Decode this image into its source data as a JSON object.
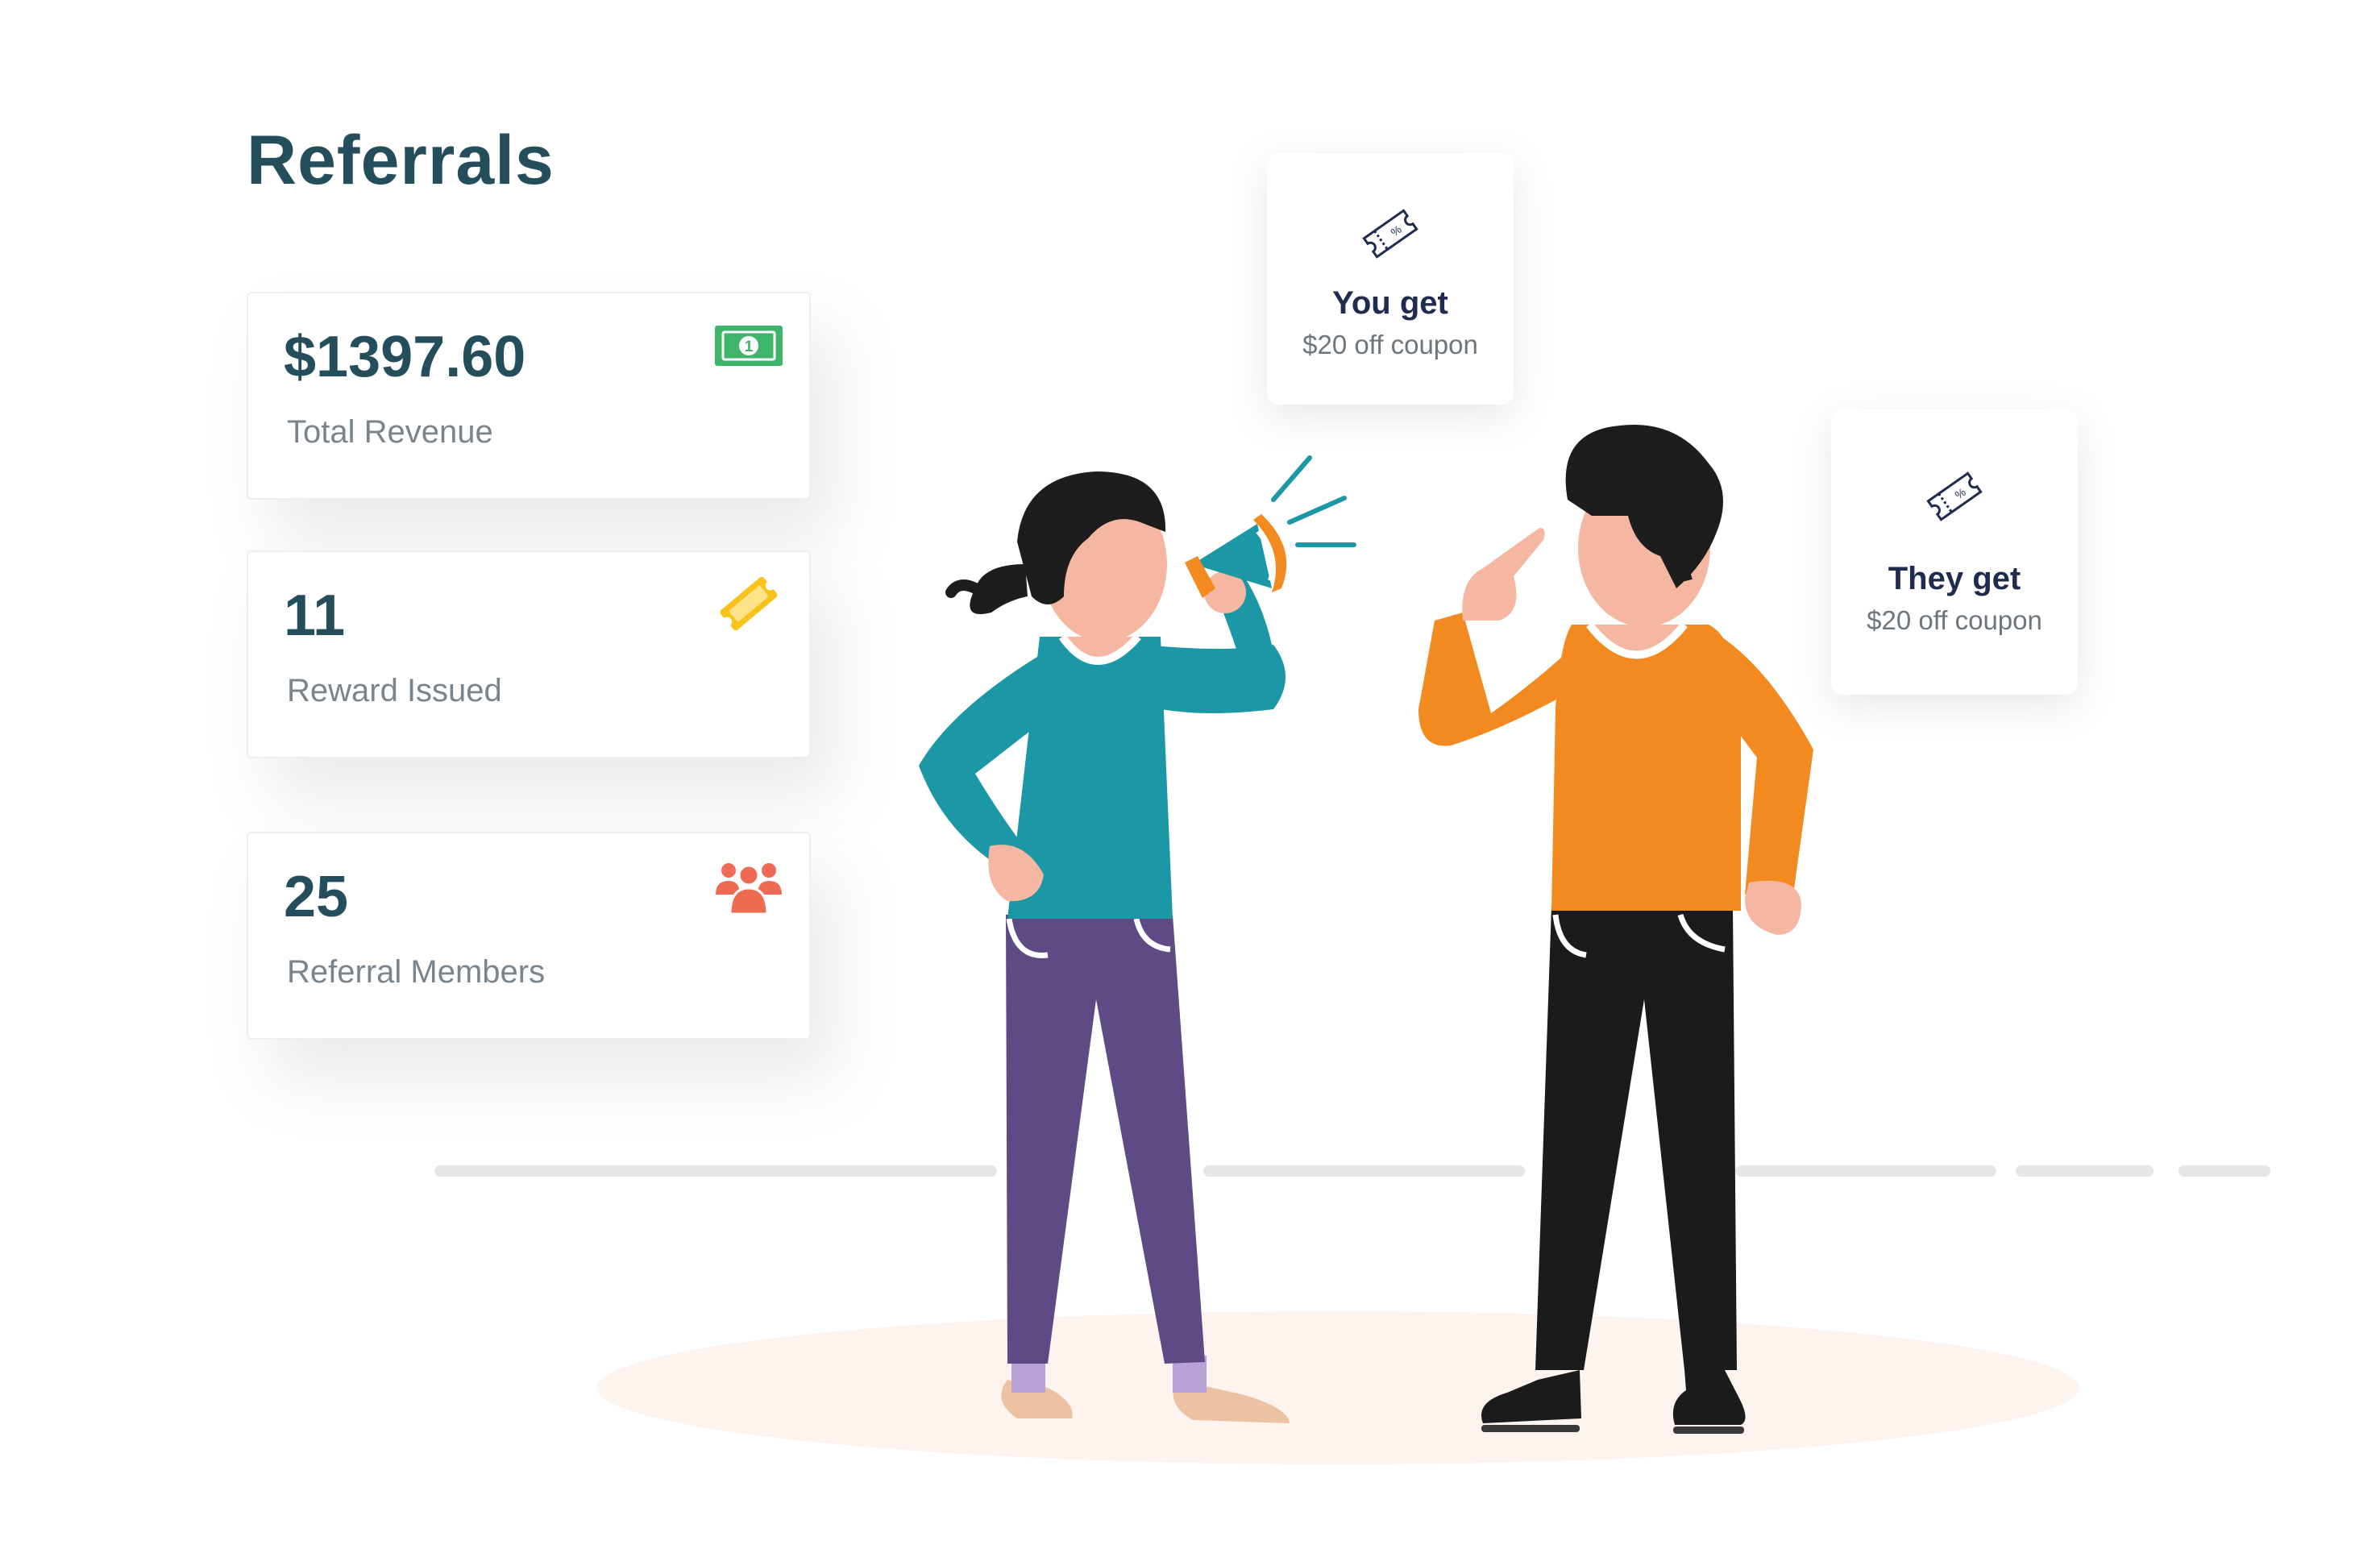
{
  "page": {
    "title": "Referrals"
  },
  "stats": [
    {
      "value": "$1397.60",
      "label": "Total Revenue",
      "icon": "cash-icon",
      "icon_color": "#3fb56c"
    },
    {
      "value": "11",
      "label": "Reward Issued",
      "icon": "ticket-icon",
      "icon_color": "#f7c21a"
    },
    {
      "value": "25",
      "label": "Referral Members",
      "icon": "users-icon",
      "icon_color": "#ef6a52"
    }
  ],
  "coupons": [
    {
      "title": "You get",
      "subtitle": "$20 off coupon",
      "icon": "coupon-icon"
    },
    {
      "title": "They get",
      "subtitle": "$20 off coupon",
      "icon": "coupon-icon"
    }
  ],
  "colors": {
    "heading": "#244e5b",
    "label": "#7a848c",
    "woman_shirt": "#1b97a5",
    "woman_pants": "#5e4a85",
    "man_shirt": "#f28a1f",
    "man_pants": "#1b1b1b",
    "megaphone": "#1b97a5",
    "megaphone_accent": "#f28a1f"
  }
}
